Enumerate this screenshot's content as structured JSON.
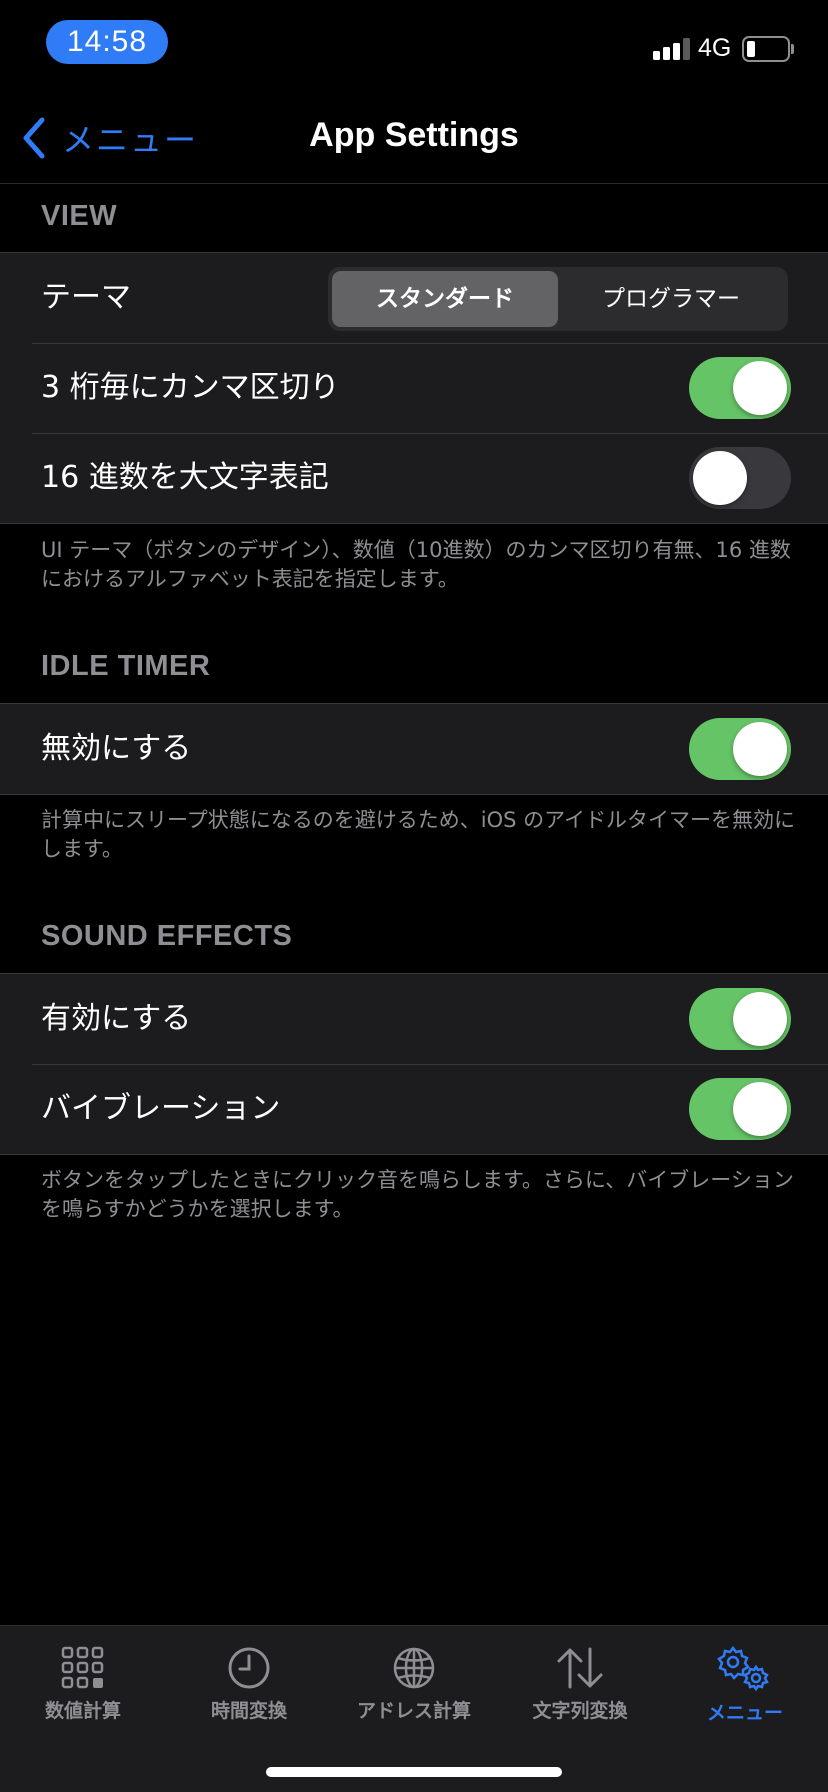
{
  "status_bar": {
    "time": "14:58",
    "network": "4G",
    "battery_level": 0.2,
    "signal_bars": 3,
    "signal_bars_max": 4
  },
  "nav": {
    "back_label": "メニュー",
    "title": "App Settings"
  },
  "sections": {
    "view": {
      "header": "VIEW",
      "theme_label": "テーマ",
      "theme_options": [
        "スタンダード",
        "プログラマー"
      ],
      "theme_selected": "スタンダード",
      "comma_label": "3 桁毎にカンマ区切り",
      "comma_on": true,
      "hex_label": "16 進数を大文字表記",
      "hex_on": false,
      "footer": "UI テーマ（ボタンのデザイン）、数値（10進数）のカンマ区切り有無、16 進数におけるアルファベット表記を指定します。"
    },
    "idle_timer": {
      "header": "IDLE TIMER",
      "disable_label": "無効にする",
      "disable_on": true,
      "footer": "計算中にスリープ状態になるのを避けるため、iOS のアイドルタイマーを無効にします。"
    },
    "sound_effects": {
      "header": "SOUND EFFECTS",
      "enable_label": "有効にする",
      "enable_on": true,
      "vibration_label": "バイブレーション",
      "vibration_on": true,
      "footer": "ボタンをタップしたときにクリック音を鳴らします。さらに、バイブレーションを鳴らすかどうかを選択します。"
    }
  },
  "tab_bar": {
    "tabs": [
      {
        "label": "数値計算",
        "icon": "grid-keypad-icon"
      },
      {
        "label": "時間変換",
        "icon": "clock-icon"
      },
      {
        "label": "アドレス計算",
        "icon": "globe-icon"
      },
      {
        "label": "文字列変換",
        "icon": "up-down-arrows-icon"
      },
      {
        "label": "メニュー",
        "icon": "gears-icon"
      }
    ],
    "active_index": 4
  },
  "colors": {
    "accent": "#2f7cf6",
    "toggle_on": "#65c466",
    "toggle_off": "#39393d",
    "row_bg": "#1c1c1e",
    "secondary_text": "#8e8e93"
  }
}
